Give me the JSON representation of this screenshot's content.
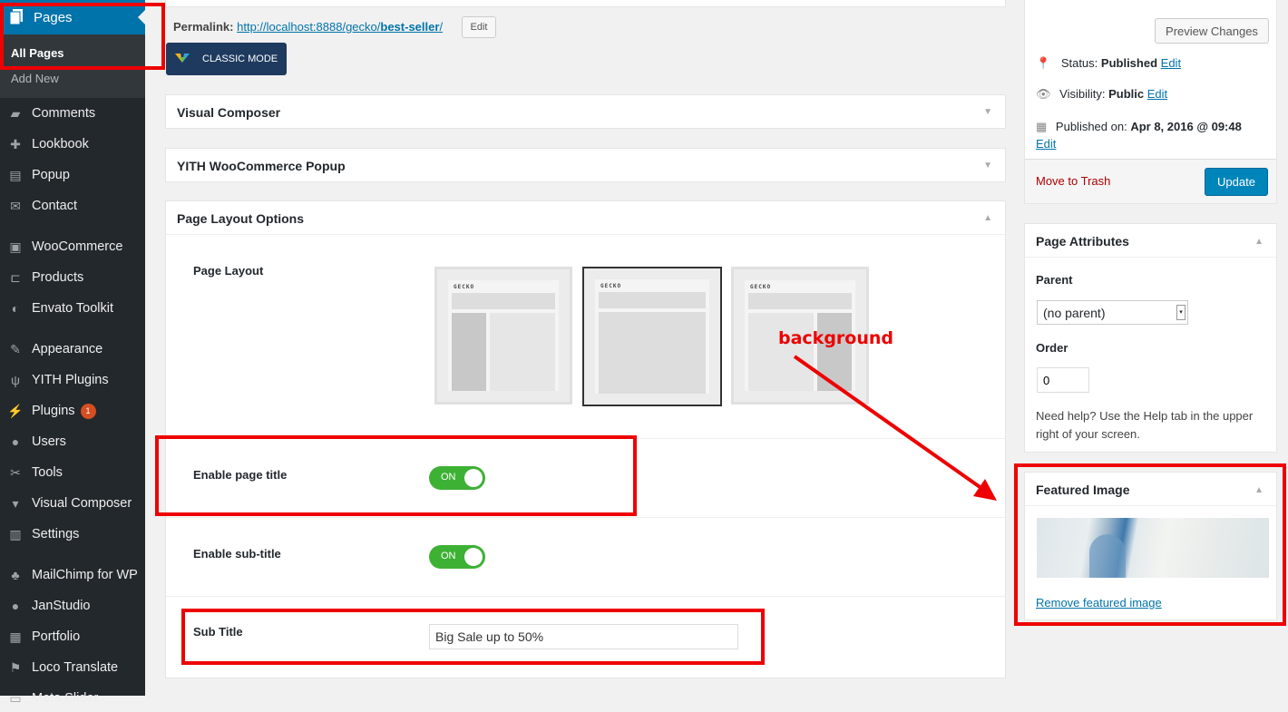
{
  "sidebar": {
    "pages_label": "Pages",
    "all_pages": "All Pages",
    "add_new": "Add New",
    "items": [
      {
        "label": "Comments",
        "icon": "comment-icon"
      },
      {
        "label": "Lookbook",
        "icon": "plus-icon"
      },
      {
        "label": "Popup",
        "icon": "popup-icon"
      },
      {
        "label": "Contact",
        "icon": "envelope-icon"
      },
      {
        "label": "WooCommerce",
        "icon": "woocommerce-icon"
      },
      {
        "label": "Products",
        "icon": "cart-icon"
      },
      {
        "label": "Envato Toolkit",
        "icon": "leaf-icon"
      },
      {
        "label": "Appearance",
        "icon": "brush-icon"
      },
      {
        "label": "YITH Plugins",
        "icon": "yith-icon"
      },
      {
        "label": "Plugins",
        "icon": "plug-icon",
        "badge": "1"
      },
      {
        "label": "Users",
        "icon": "user-icon"
      },
      {
        "label": "Tools",
        "icon": "wrench-icon"
      },
      {
        "label": "Visual Composer",
        "icon": "vc-icon"
      },
      {
        "label": "Settings",
        "icon": "settings-icon"
      },
      {
        "label": "MailChimp for WP",
        "icon": "mailchimp-icon"
      },
      {
        "label": "JanStudio",
        "icon": "user-icon"
      },
      {
        "label": "Portfolio",
        "icon": "portfolio-icon"
      },
      {
        "label": "Loco Translate",
        "icon": "translate-icon"
      },
      {
        "label": "Meta Slider",
        "icon": "slider-icon"
      }
    ]
  },
  "permalink": {
    "label": "Permalink:",
    "url_prefix": "http://localhost:8888/gecko/",
    "slug": "best-seller",
    "url_suffix": "/",
    "edit": "Edit"
  },
  "classic_mode": "CLASSIC MODE",
  "boxes": {
    "visual_composer": "Visual Composer",
    "yith_popup": "YITH WooCommerce Popup",
    "layout_options": "Page Layout Options"
  },
  "layout": {
    "page_layout_label": "Page Layout",
    "logo_text": "GECKO",
    "selected": "full-width"
  },
  "options": {
    "enable_title": {
      "label": "Enable page title",
      "state": "ON"
    },
    "enable_subtitle": {
      "label": "Enable sub-title",
      "state": "ON"
    },
    "sub_title": {
      "label": "Sub Title",
      "value": "Big Sale up to 50%"
    }
  },
  "annotation": {
    "text": "background",
    "color": "#e00000"
  },
  "publish": {
    "preview": "Preview Changes",
    "status_label": "Status:",
    "status_value": "Published",
    "visibility_label": "Visibility:",
    "visibility_value": "Public",
    "published_label": "Published on:",
    "published_value": "Apr 8, 2016 @ 09:48",
    "edit": "Edit",
    "trash": "Move to Trash",
    "update": "Update"
  },
  "attributes": {
    "title": "Page Attributes",
    "parent_label": "Parent",
    "parent_value": "(no parent)",
    "order_label": "Order",
    "order_value": "0",
    "help": "Need help? Use the Help tab in the upper right of your screen."
  },
  "featured": {
    "title": "Featured Image",
    "remove": "Remove featured image"
  },
  "colors": {
    "accent": "#0073aa",
    "toggle_on": "#3db134",
    "highlight": "#e00000",
    "sidebar": "#23282d"
  }
}
